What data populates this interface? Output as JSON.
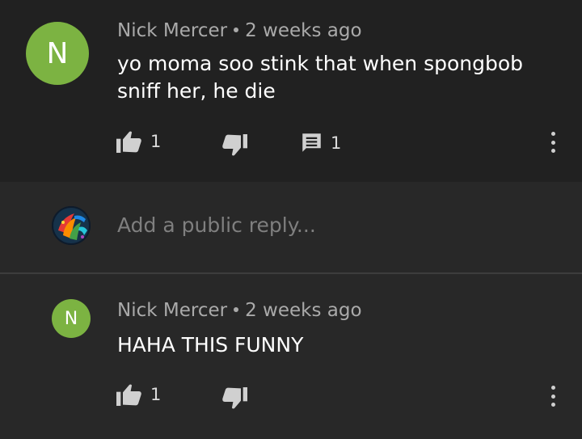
{
  "comment": {
    "avatar_letter": "N",
    "author": "Nick Mercer",
    "time": "2 weeks ago",
    "text_line1": "yo moma soo stink that when spongbob",
    "text_line2": "sniff her, he die",
    "likes": "1",
    "replies": "1"
  },
  "reply_box": {
    "placeholder": "Add a public reply..."
  },
  "reply": {
    "avatar_letter": "N",
    "author": "Nick Mercer",
    "time": "2 weeks ago",
    "text": "HAHA THIS FUNNY",
    "likes": "1"
  },
  "colors": {
    "background": "#212121",
    "reply_background": "#282828",
    "avatar_green": "#7cb342",
    "meta_gray": "#aaaaaa"
  },
  "icons": [
    "thumbs-up-icon",
    "thumbs-down-icon",
    "comment-icon",
    "more-vert-icon"
  ]
}
